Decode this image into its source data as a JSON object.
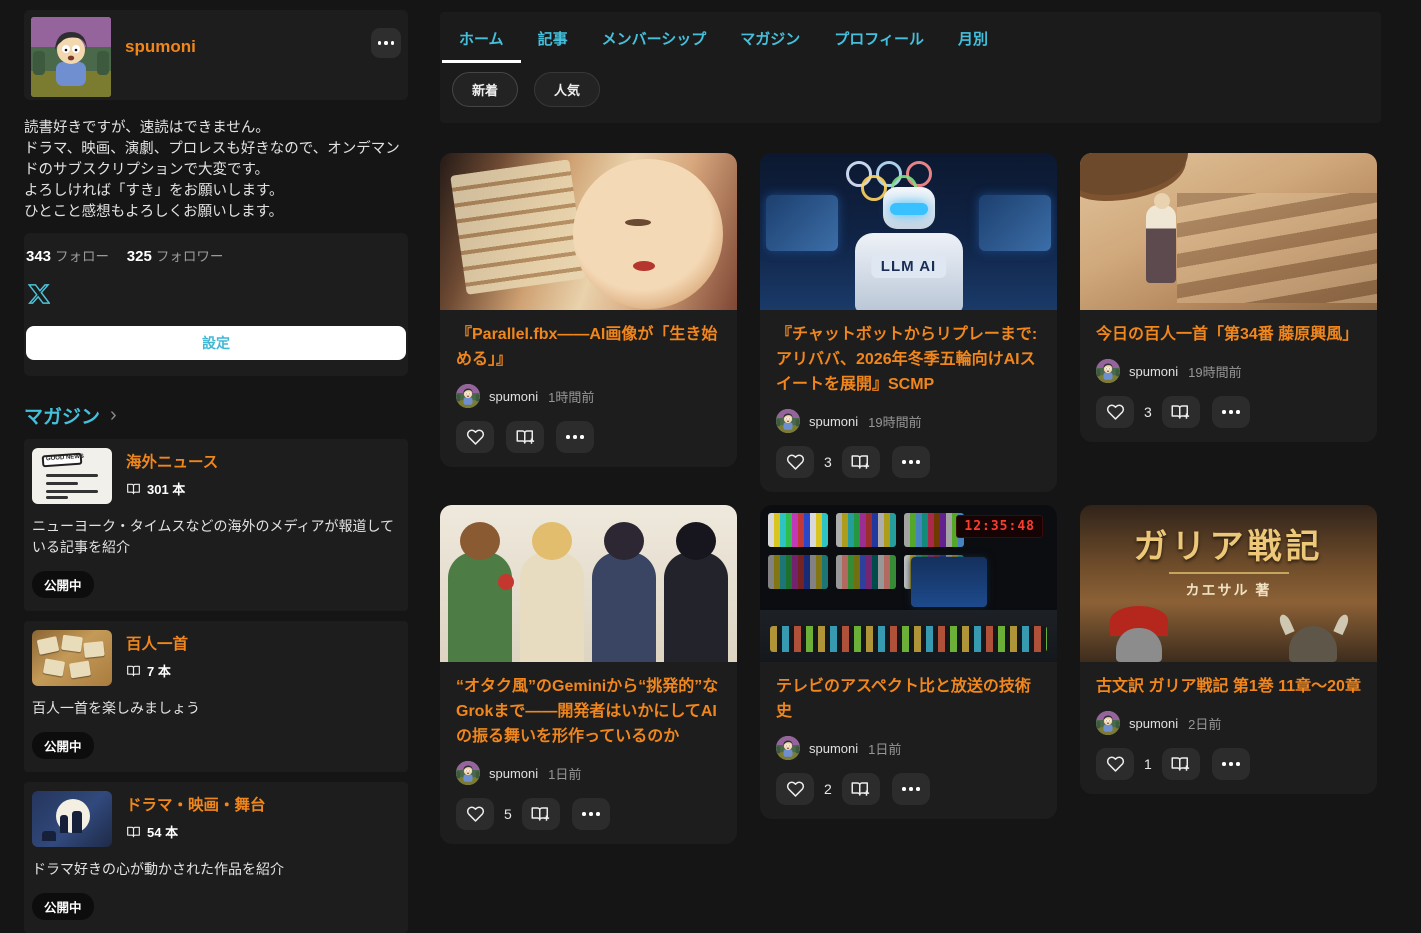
{
  "colors": {
    "background": "#151515",
    "panel": "#1d1d1d",
    "accent_orange": "#f0861c",
    "accent_cyan": "#45c0dc",
    "settings_text": "#3fb8d6",
    "badge_background": "#0d0d0d",
    "led_clock_red": "#ff3b30"
  },
  "icons": {
    "more": "ellipsis-3-dots",
    "x_logo": "X (Twitter) logo",
    "book": "open-book",
    "heart": "heart-outline",
    "add_to_magazine": "open-book-with-plus",
    "chevron": "›"
  },
  "profile": {
    "name": "spumoni",
    "bio": "読書好きですが、速読はできません。\nドラマ、映画、演劇、プロレスも好きなので、オンデマンドのサブスクリプションで大変です。\nよろしければ「すき」をお願いします。\nひとこと感想もよろしくお願いします。",
    "stats": {
      "following_value": "343",
      "following_label": "フォロー",
      "followers_value": "325",
      "followers_label": "フォロワー"
    },
    "settings_button": "設定"
  },
  "magazine": {
    "heading": "マガジン",
    "items": [
      {
        "title": "海外ニュース",
        "count": "301 本",
        "description": "ニューヨーク・タイムスなどの海外のメディアが報道している記事を紹介",
        "status": "公開中",
        "thumb_text": "GOOD NEWS"
      },
      {
        "title": "百人一首",
        "count": "7 本",
        "description": "百人一首を楽しみましょう",
        "status": "公開中"
      },
      {
        "title": "ドラマ・映画・舞台",
        "count": "54 本",
        "description": "ドラマ好きの心が動かされた作品を紹介",
        "status": "公開中"
      }
    ]
  },
  "tabs": [
    "ホーム",
    "記事",
    "メンバーシップ",
    "マガジン",
    "プロフィール",
    "月別"
  ],
  "active_tab": "ホーム",
  "filters": [
    "新着",
    "人気"
  ],
  "articles": [
    {
      "title": "『Parallel.fbx——AI画像が「生き始める」』",
      "author": "spumoni",
      "time": "1時間前",
      "likes": ""
    },
    {
      "title": "『チャットボットからリプレーまで:アリババ、2026年冬季五輪向けAIスイートを展開』SCMP",
      "author": "spumoni",
      "time": "19時間前",
      "likes": "3",
      "image_label": "LLM AI"
    },
    {
      "title": "今日の百人一首「第34番 藤原興風」",
      "author": "spumoni",
      "time": "19時間前",
      "likes": "3"
    },
    {
      "title": "“オタク風”のGeminiから“挑発的”なGrokまで——開発者はいかにしてAIの振る舞いを形作っているのか",
      "author": "spumoni",
      "time": "1日前",
      "likes": "5"
    },
    {
      "title": "テレビのアスペクト比と放送の技術史",
      "author": "spumoni",
      "time": "1日前",
      "likes": "2",
      "image_clock": "12:35:48"
    },
    {
      "title": "古文訳 ガリア戦記 第1巻 11章〜20章",
      "author": "spumoni",
      "time": "2日前",
      "likes": "1",
      "image_title": "ガリア戦記",
      "image_author": "カエサル 著"
    }
  ]
}
